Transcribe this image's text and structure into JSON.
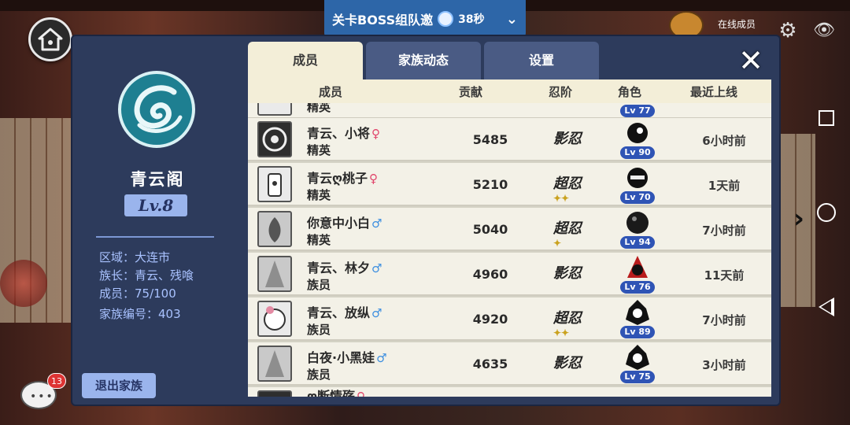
{
  "boss_banner": {
    "title": "关卡BOSS组队邀",
    "seconds": "38秒"
  },
  "online": {
    "label": "在线成员"
  },
  "panel": {
    "tabs": [
      {
        "label": "成员",
        "active": true
      },
      {
        "label": "家族动态",
        "active": false
      },
      {
        "label": "设置",
        "active": false
      }
    ],
    "close_label": "✕"
  },
  "clan": {
    "name": "青云阁",
    "level": "Lv.8",
    "region": "区域：大连市",
    "leader": "族长：青云、残喰",
    "members": "成员：75/100",
    "clan_id": "家族编号：403",
    "leave_label": "退出家族"
  },
  "chat": {
    "badge": "13"
  },
  "table": {
    "headers": {
      "member": "成员",
      "contribution": "贡献",
      "rank": "忍阶",
      "role": "角色",
      "last_online": "最近上线"
    },
    "partial_top": {
      "rank": "精英",
      "lv": "Lv 77"
    },
    "rows": [
      {
        "name": "青云、小将",
        "gender": "♀",
        "rank": "精英",
        "contribution": "5485",
        "ninja_rank": "影忍",
        "lv": "Lv 90",
        "last_online": "6小时前"
      },
      {
        "name": "青云ღ桃子",
        "gender": "♀",
        "rank": "精英",
        "contribution": "5210",
        "ninja_rank": "超忍",
        "lv": "Lv 70",
        "last_online": "1天前"
      },
      {
        "name": "你意中小白",
        "gender": "♂",
        "rank": "精英",
        "contribution": "5040",
        "ninja_rank": "超忍",
        "lv": "Lv 94",
        "last_online": "7小时前"
      },
      {
        "name": "青云、林夕",
        "gender": "♂",
        "rank": "族员",
        "contribution": "4960",
        "ninja_rank": "影忍",
        "lv": "Lv 76",
        "last_online": "11天前"
      },
      {
        "name": "青云、放纵",
        "gender": "♂",
        "rank": "族员",
        "contribution": "4920",
        "ninja_rank": "超忍",
        "lv": "Lv 89",
        "last_online": "7小时前"
      },
      {
        "name": "白夜·小黑娃",
        "gender": "♂",
        "rank": "族员",
        "contribution": "4635",
        "ninja_rank": "影忍",
        "lv": "Lv 75",
        "last_online": "3小时前"
      }
    ],
    "partial_bottom": {
      "name": "ღ断情殇",
      "gender": "♀"
    }
  },
  "colors": {
    "female": "#e0446a",
    "male": "#3d8fe0",
    "panel": "#2d3b5c",
    "row": "#f3f1e7"
  }
}
